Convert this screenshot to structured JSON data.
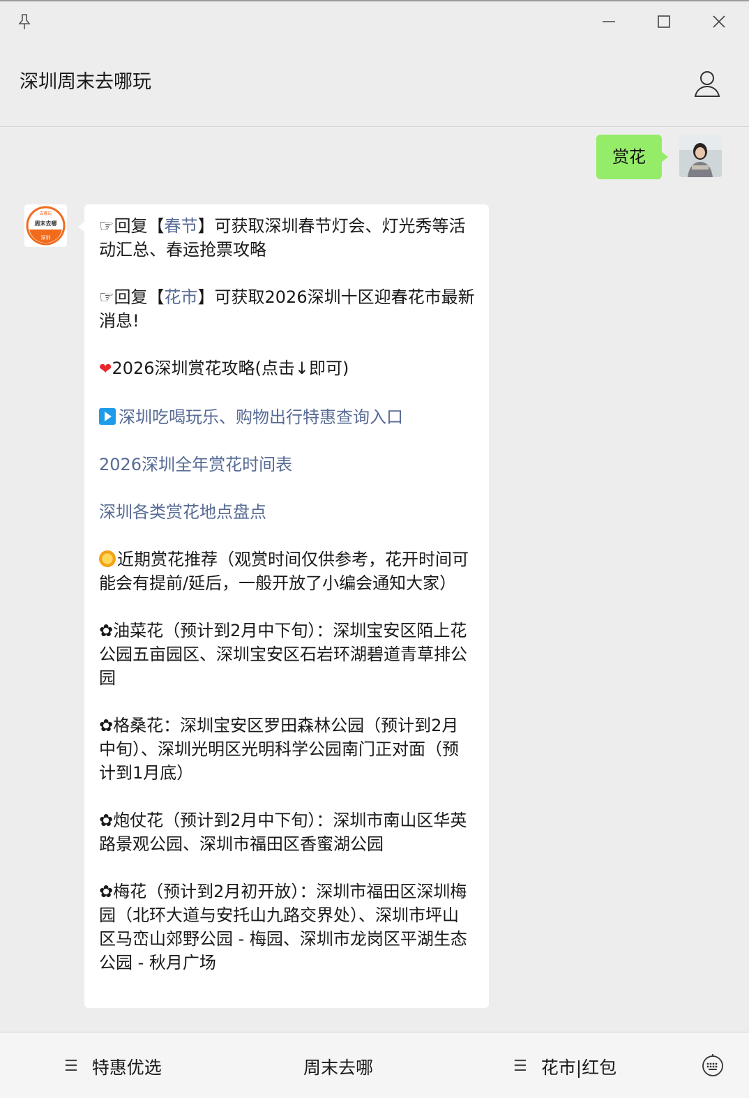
{
  "window": {
    "title": "深圳周末去哪玩"
  },
  "messages": {
    "outgoing": {
      "text": "赏花"
    },
    "bot_logo": {
      "top": "去哪玩",
      "middle": "周末去哪",
      "bottom": "深圳"
    },
    "incoming": {
      "reply1_prefix": "☞回复【",
      "reply1_keyword": "春节",
      "reply1_suffix": "】可获取深圳春节灯会、灯光秀等活动汇总、春运抢票攻略",
      "reply2_prefix": "☞回复【",
      "reply2_keyword": "花市",
      "reply2_suffix": "】可获取2026深圳十区迎春花市最新消息!",
      "guide_text": "2026深圳赏花攻略(点击↓即可)",
      "link_deals": "深圳吃喝玩乐、购物出行特惠查询入口",
      "link_timetable": "2026深圳全年赏花时间表",
      "link_locations": "深圳各类赏花地点盘点",
      "recommend_text": "近期赏花推荐（观赏时间仅供参考，花开时间可能会有提前/延后，一般开放了小编会通知大家）",
      "item1": "✿油菜花（预计到2月中下旬）：深圳宝安区陌上花公园五亩园区、深圳宝安区石岩环湖碧道青草排公园",
      "item2": "✿格桑花：深圳宝安区罗田森林公园（预计到2月中旬）、深圳光明区光明科学公园南门正对面（预计到1月底）",
      "item3": "✿炮仗花（预计到2月中下旬）：深圳市南山区华英路景观公园、深圳市福田区香蜜湖公园",
      "item4": "✿梅花（预计到2月初开放）：深圳市福田区深圳梅园（北环大道与安托山九路交界处）、深圳市坪山区马峦山郊野公园 - 梅园、深圳市龙岗区平湖生态公园 - 秋月广场"
    }
  },
  "footer_menu": {
    "item1": "特惠优选",
    "item2": "周末去哪",
    "item3": "花市|红包"
  },
  "colors": {
    "outgoing_bubble": "#95ec69",
    "link": "#576b95",
    "background": "#ededed"
  },
  "icons": [
    "pin-icon",
    "minimize-icon",
    "maximize-icon",
    "close-icon",
    "profile-icon",
    "heart-icon",
    "play-icon",
    "sun-icon",
    "menu-lines-icon",
    "keyboard-icon"
  ]
}
